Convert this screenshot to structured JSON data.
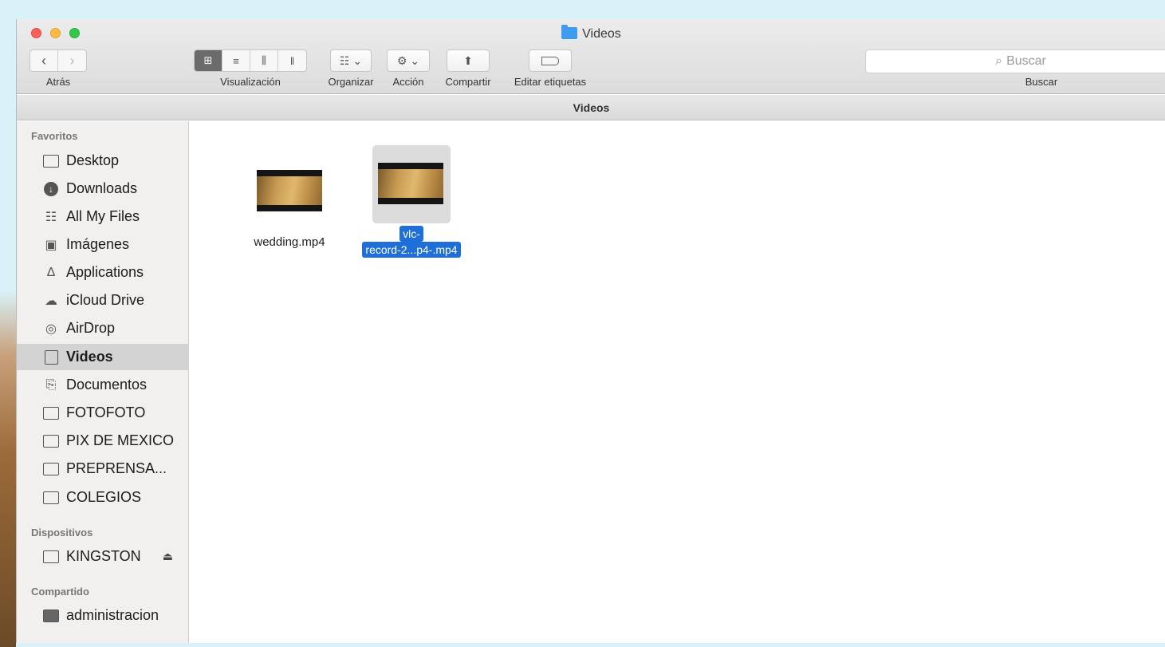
{
  "window": {
    "title": "Videos"
  },
  "toolbar": {
    "back_label": "Atrás",
    "view_label": "Visualización",
    "arrange_label": "Organizar",
    "action_label": "Acción",
    "share_label": "Compartir",
    "tags_label": "Editar etiquetas",
    "search_placeholder": "Buscar",
    "search_label": "Buscar"
  },
  "pathbar": {
    "title": "Videos"
  },
  "sidebar": {
    "favorites_header": "Favoritos",
    "favorites": [
      {
        "label": "Desktop",
        "icon": "desktop-icon"
      },
      {
        "label": "Downloads",
        "icon": "downloads-icon"
      },
      {
        "label": "All My Files",
        "icon": "all-files-icon"
      },
      {
        "label": "Imágenes",
        "icon": "camera-icon"
      },
      {
        "label": "Applications",
        "icon": "applications-icon"
      },
      {
        "label": "iCloud Drive",
        "icon": "cloud-icon"
      },
      {
        "label": "AirDrop",
        "icon": "airdrop-icon"
      },
      {
        "label": "Videos",
        "icon": "film-icon",
        "selected": true
      },
      {
        "label": "Documentos",
        "icon": "documents-icon"
      },
      {
        "label": "FOTOFOTO",
        "icon": "folder-icon"
      },
      {
        "label": "PIX DE MEXICO",
        "icon": "folder-icon"
      },
      {
        "label": "PREPRENSA...",
        "icon": "folder-icon"
      },
      {
        "label": "COLEGIOS",
        "icon": "folder-icon"
      }
    ],
    "devices_header": "Dispositivos",
    "devices": [
      {
        "label": "KINGSTON",
        "icon": "drive-icon"
      }
    ],
    "shared_header": "Compartido",
    "shared": [
      {
        "label": "administracion",
        "icon": "computer-icon"
      }
    ]
  },
  "files": [
    {
      "name": "wedding.mp4",
      "selected": false
    },
    {
      "name_line1": "vlc-",
      "name_line2": "record-2...p4-.mp4",
      "selected": true
    }
  ]
}
